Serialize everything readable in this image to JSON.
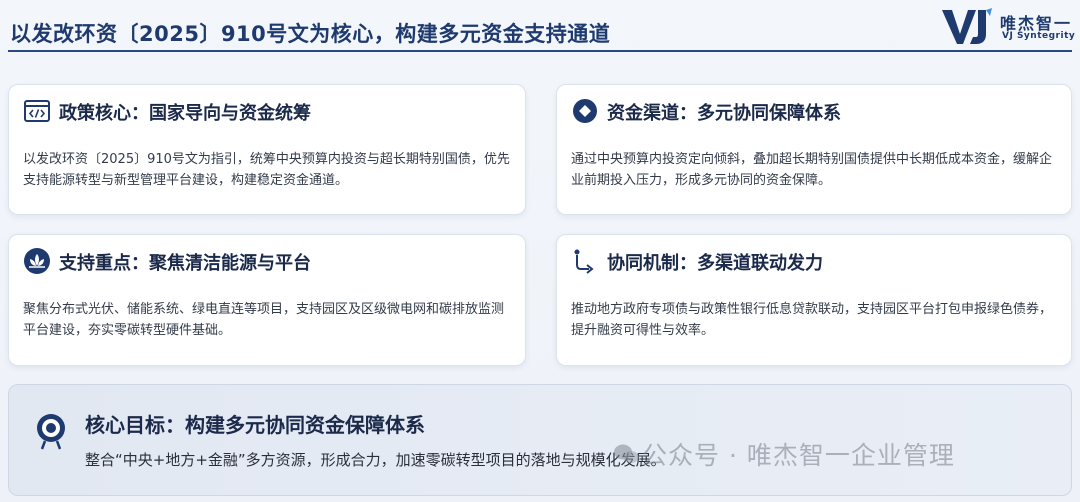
{
  "header": {
    "title": "以发改环资〔2025〕910号文为核心，构建多元资金支持通道"
  },
  "logo": {
    "mark": "VJ",
    "cn": "唯杰智一",
    "en": "VJ Syntegrity",
    "color": "#1e3a6e"
  },
  "cards": [
    {
      "icon": "code-window-icon",
      "title": "政策核心：国家导向与资金统筹",
      "body": "以发改环资〔2025〕910号文为指引，统筹中央预算内投资与超长期特别国债，优先支持能源转型与新型管理平台建设，构建稳定资金通道。"
    },
    {
      "icon": "diamond-circle-icon",
      "title": "资金渠道：多元协同保障体系",
      "body": "通过中央预算内投资定向倾斜，叠加超长期特别国债提供中长期低成本资金，缓解企业前期投入压力，形成多元协同的资金保障。"
    },
    {
      "icon": "lotus-icon",
      "title": "支持重点：聚焦清洁能源与平台",
      "body": "聚焦分布式光伏、储能系统、绿电直连等项目，支持园区及区级微电网和碳排放监测平台建设，夯实零碳转型硬件基础。"
    },
    {
      "icon": "route-icon",
      "title": "协同机制：多渠道联动发力",
      "body": "推动地方政府专项债与政策性银行低息贷款联动，支持园区平台打包申报绿色债券，提升融资可得性与效率。"
    }
  ],
  "goal": {
    "icon": "target-icon",
    "title": "核心目标：构建多元协同资金保障体系",
    "body": "整合“中央+地方+金融”多方资源，形成合力，加速零碳转型项目的落地与规模化发展。"
  },
  "watermark": {
    "icon": "wechat-icon",
    "text": "公众号 · 唯杰智一企业管理"
  },
  "colors": {
    "accent": "#1e3a6e",
    "card_bg": "#ffffff",
    "page_bg": "#f3f6fb"
  }
}
